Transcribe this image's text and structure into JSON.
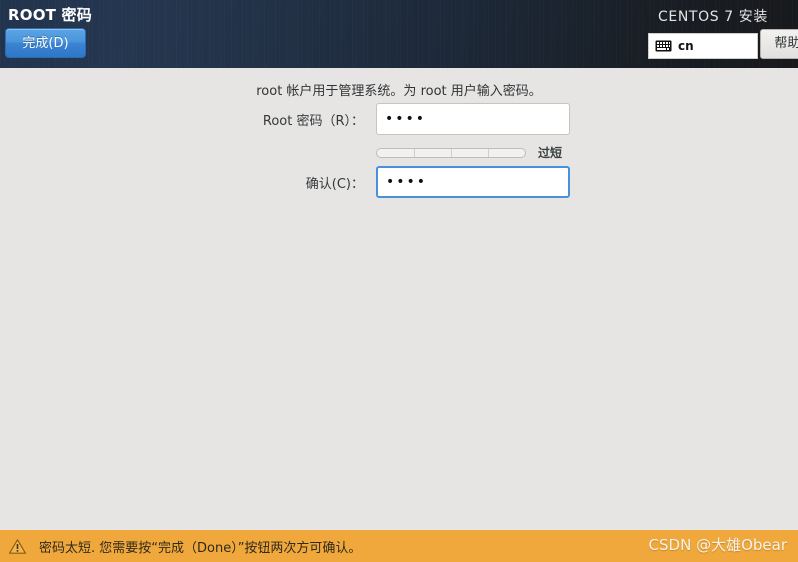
{
  "header": {
    "spoke_title": "ROOT 密码",
    "done_label": "完成(D)",
    "distro_title": "CENTOS 7 安装",
    "keyboard_layout": "cn",
    "keyboard_icon": "keyboard-icon",
    "help_label": "帮助!"
  },
  "main": {
    "intro": "root 帐户用于管理系统。为 root 用户输入密码。",
    "password_field": {
      "label": "Root 密码（R）：",
      "value": "••••",
      "placeholder": "",
      "focused": false
    },
    "strength": {
      "segments": 4,
      "filled": 0,
      "label": "过短"
    },
    "confirm_field": {
      "label": "确认(C)：",
      "value": "••••",
      "placeholder": "",
      "focused": true
    }
  },
  "warning": {
    "icon": "warning-triangle-icon",
    "text": "密码太短. 您需要按“完成（Done）”按钮两次方可确认。"
  },
  "watermark": "CSDN @大雄Obear",
  "colors": {
    "header_left": "#22344d",
    "header_right": "#17191c",
    "accent_blue": "#4a90d9",
    "done_button": "#3a84d2",
    "content_bg": "#e7e5e3",
    "warning_bg": "#f0a83c"
  }
}
